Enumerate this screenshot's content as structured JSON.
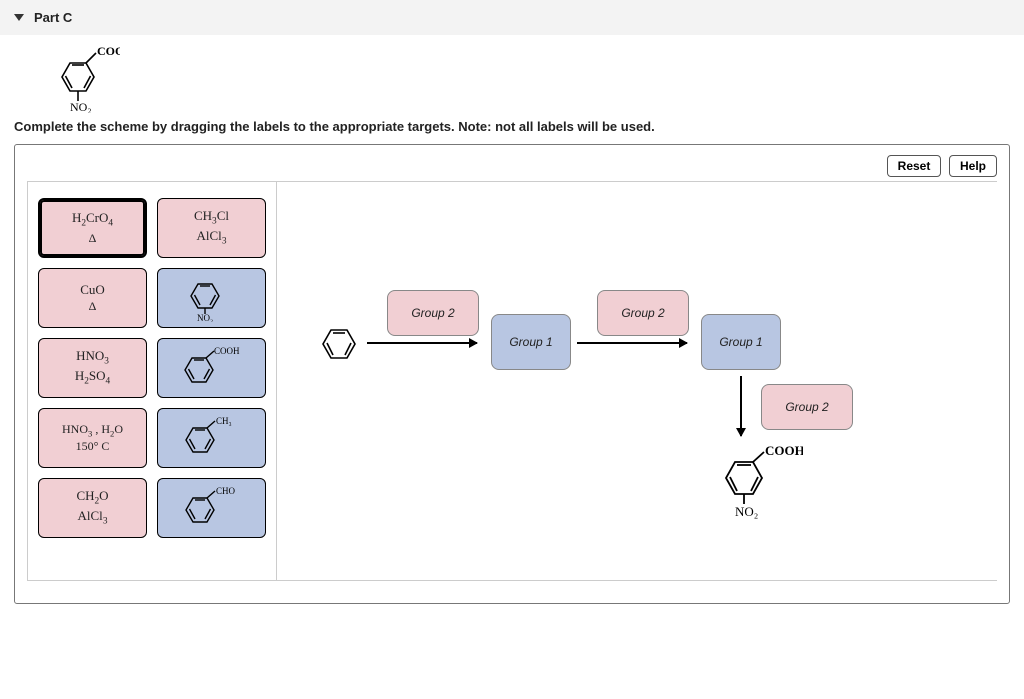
{
  "header": {
    "title": "Part C"
  },
  "prompt_molecule": {
    "top_label": "COOH",
    "bottom_label": "NO₂"
  },
  "instruction": "Complete the scheme by dragging the labels to the appropriate targets. Note: not all labels will be used.",
  "buttons": {
    "reset": "Reset",
    "help": "Help"
  },
  "labels": {
    "delta": "Δ",
    "group1": "Group 1",
    "group2": "Group 2"
  },
  "palette": {
    "r1c1_l1": "H₂CrO₄",
    "r1c2_l1": "CH₃Cl",
    "r1c2_l2": "AlCl₃",
    "r2c1_l1": "CuO",
    "r2c2_sub": "NO₂",
    "r3c1_l1": "HNO₃",
    "r3c1_l2": "H₂SO₄",
    "r3c2_sub": "COOH",
    "r4c1_l1": "HNO₃ , H₂O",
    "r4c1_l2": "150° C",
    "r4c2_sub": "CH₃",
    "r5c1_l1": "CH₂O",
    "r5c1_l2": "AlCl₃",
    "r5c2_sub": "CHO"
  },
  "product": {
    "top_label": "COOH",
    "bottom_label": "NO₂"
  }
}
